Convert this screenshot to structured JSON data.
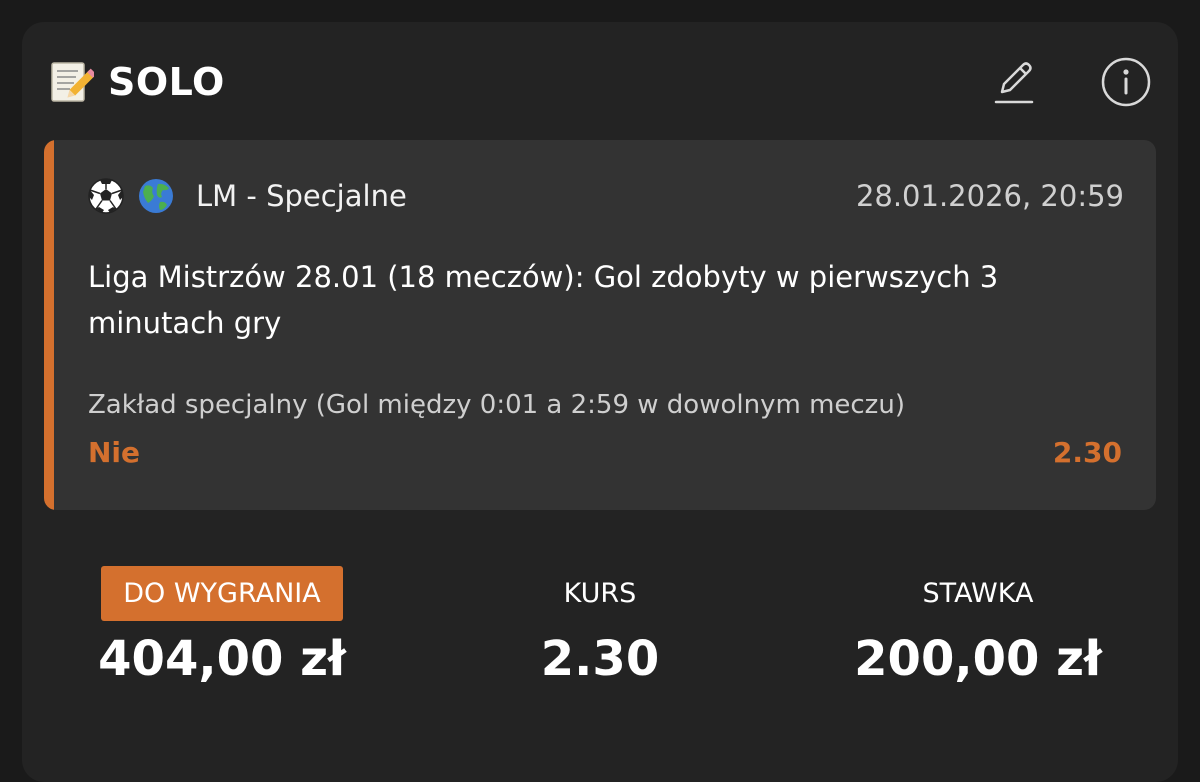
{
  "header": {
    "title": "SOLO",
    "memo_icon": "memo-icon",
    "edit_icon": "pencil-icon",
    "info_icon": "info-icon"
  },
  "bet": {
    "sport_icon": "soccer-ball-icon",
    "region_icon": "globe-icon",
    "league": "LM - Specjalne",
    "datetime": "28.01.2026, 20:59",
    "market": "Liga Mistrzów 28.01 (18 meczów): Gol zdobyty w pierwszych 3 minutach gry",
    "bet_type": "Zakład specjalny (Gol między 0:01 a 2:59 w dowolnym meczu)",
    "pick": "Nie",
    "odds": "2.30"
  },
  "summary": {
    "win_label": "DO WYGRANIA",
    "win_value": "404,00 zł",
    "odds_label": "KURS",
    "odds_value": "2.30",
    "stake_label": "STAWKA",
    "stake_value": "200,00 zł"
  },
  "colors": {
    "accent": "#d4702e",
    "card_bg": "#232323",
    "bet_box_bg": "#333333",
    "page_bg": "#1a1a1a"
  }
}
